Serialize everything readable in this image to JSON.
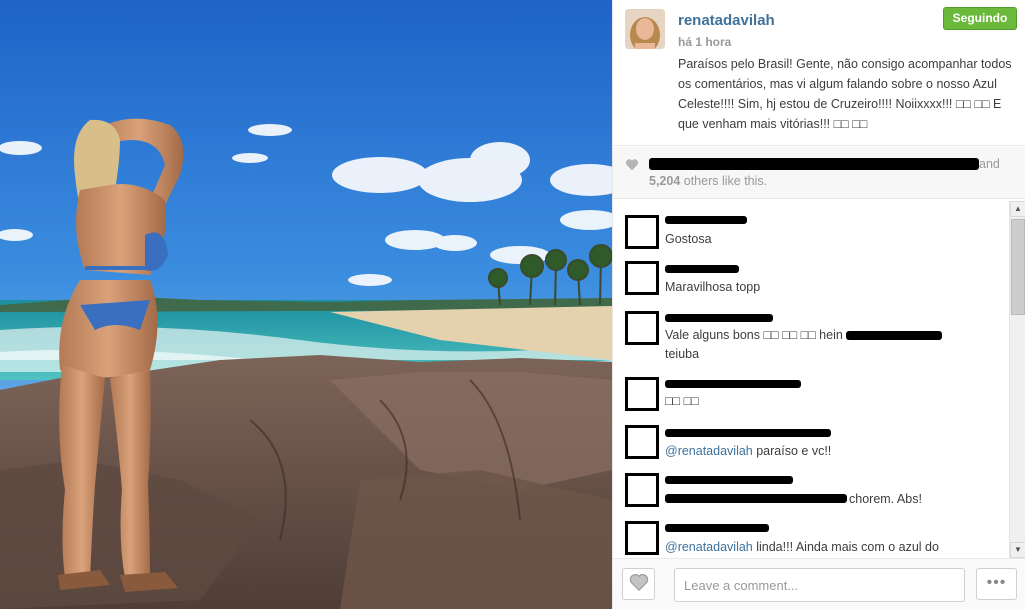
{
  "post": {
    "username": "renatadavilah",
    "time": "há 1 hora",
    "follow_label": "Seguindo",
    "caption": "Paraísos pelo Brasil! Gente, não consigo acompanhar todos os comentários, mas vi algum falando sobre o nosso Azul Celeste!!!! Sim, hj estou de Cruzeiro!!!! Noiixxxx!!! □□ □□ E que venham mais vitórias!!! □□ □□"
  },
  "likes": {
    "names_suffix": "and",
    "count": "5,204",
    "count_suffix": " others like this."
  },
  "comments": [
    {
      "text": "Gostosa"
    },
    {
      "text": "Maravilhosa topp"
    },
    {
      "text_before": "Vale alguns bons □□ □□ □□ hein",
      "text_after": "teiuba"
    },
    {
      "text": "□□ □□"
    },
    {
      "mention": "@renatadavilah",
      "text": " paraíso e vc!!"
    },
    {
      "text": "chorem. Abs!"
    },
    {
      "mention": "@renatadavilah",
      "text": " linda!!! Ainda mais com o azul do"
    }
  ],
  "footer": {
    "comment_placeholder": "Leave a comment...",
    "more_label": "•••"
  },
  "icons": {
    "like": "heart-icon",
    "more": "ellipsis-icon",
    "scroll_up": "scroll-up-arrow-icon",
    "scroll_down": "scroll-down-arrow-icon"
  },
  "colors": {
    "link": "#3f729b",
    "follow_green": "#6bb93a",
    "likes_bg": "#f7f7f7"
  }
}
